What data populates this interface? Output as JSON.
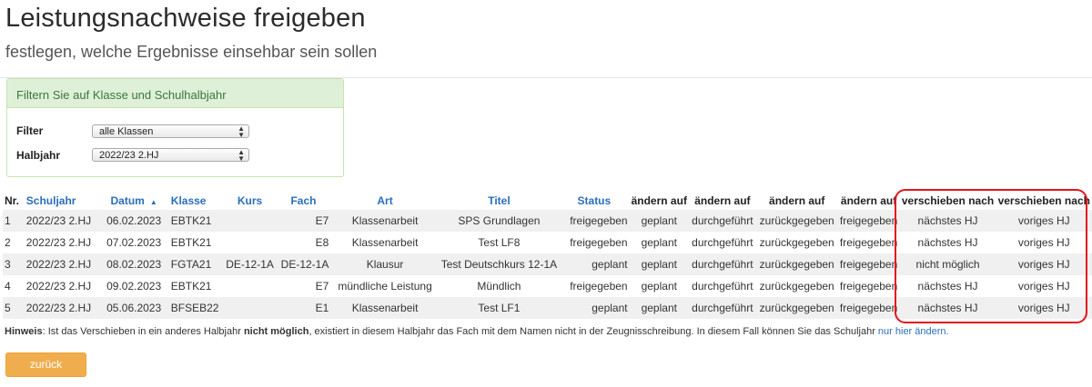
{
  "header": {
    "title": "Leistungsnachweise freigeben",
    "subtitle": "festlegen, welche Ergebnisse einsehbar sein sollen"
  },
  "filter_panel": {
    "heading": "Filtern Sie auf Klasse und Schulhalbjahr",
    "filter_label": "Filter",
    "filter_value": "alle Klassen",
    "halbjahr_label": "Halbjahr",
    "halbjahr_value": "2022/23 2.HJ"
  },
  "table": {
    "columns": [
      "Nr.",
      "Schuljahr",
      "Datum",
      "Klasse",
      "Kurs",
      "Fach",
      "Art",
      "Titel",
      "Status",
      "ändern auf",
      "ändern auf",
      "ändern auf",
      "ändern auf",
      "verschieben nach",
      "verschieben nach"
    ],
    "rows": [
      {
        "nr": "1",
        "schuljahr": "2022/23 2.HJ",
        "datum": "06.02.2023",
        "klasse": "EBTK21",
        "kurs": "",
        "fach": "E7",
        "art": "Klassenarbeit",
        "titel": "SPS Grundlagen",
        "status": "freigegeben",
        "a1": "geplant",
        "a2": "durchgeführt",
        "a3": "zurückgegeben",
        "a4": "freigegeben",
        "v1": "nächstes HJ",
        "v2": "voriges HJ"
      },
      {
        "nr": "2",
        "schuljahr": "2022/23 2.HJ",
        "datum": "07.02.2023",
        "klasse": "EBTK21",
        "kurs": "",
        "fach": "E8",
        "art": "Klassenarbeit",
        "titel": "Test LF8",
        "status": "freigegeben",
        "a1": "geplant",
        "a2": "durchgeführt",
        "a3": "zurückgegeben",
        "a4": "freigegeben",
        "v1": "nächstes HJ",
        "v2": "voriges HJ"
      },
      {
        "nr": "3",
        "schuljahr": "2022/23 2.HJ",
        "datum": "08.02.2023",
        "klasse": "FGTA21",
        "kurs": "DE-12-1A",
        "fach": "DE-12-1A",
        "art": "Klausur",
        "titel": "Test Deutschkurs 12-1A",
        "status": "geplant",
        "a1": "geplant",
        "a2": "durchgeführt",
        "a3": "zurückgegeben",
        "a4": "freigegeben",
        "v1": "nicht möglich",
        "v2": "voriges HJ"
      },
      {
        "nr": "4",
        "schuljahr": "2022/23 2.HJ",
        "datum": "09.02.2023",
        "klasse": "EBTK21",
        "kurs": "",
        "fach": "E7",
        "art": "mündliche Leistung",
        "titel": "Mündlich",
        "status": "freigegeben",
        "a1": "geplant",
        "a2": "durchgeführt",
        "a3": "zurückgegeben",
        "a4": "freigegeben",
        "v1": "nächstes HJ",
        "v2": "voriges HJ"
      },
      {
        "nr": "5",
        "schuljahr": "2022/23 2.HJ",
        "datum": "05.06.2023",
        "klasse": "BFSEB22",
        "kurs": "",
        "fach": "E1",
        "art": "Klassenarbeit",
        "titel": "Test LF1",
        "status": "geplant",
        "a1": "geplant",
        "a2": "durchgeführt",
        "a3": "zurückgegeben",
        "a4": "freigegeben",
        "v1": "nächstes HJ",
        "v2": "voriges HJ"
      }
    ]
  },
  "hint": {
    "label": "Hinweis",
    "text1": ": Ist das Verschieben in ein anderes Halbjahr ",
    "bold": "nicht möglich",
    "text2": ", existiert in diesem Halbjahr das Fach mit dem Namen nicht in der Zeugnisschreibung. In diesem Fall können Sie das Schuljahr ",
    "link": "nur hier ändern."
  },
  "back_button": "zurück",
  "colors": {
    "link": "#2a6ebb",
    "panel_header_bg": "#dff0d8",
    "panel_header_text": "#3c763d",
    "button": "#f0ad4e",
    "highlight": "#e3141b"
  }
}
